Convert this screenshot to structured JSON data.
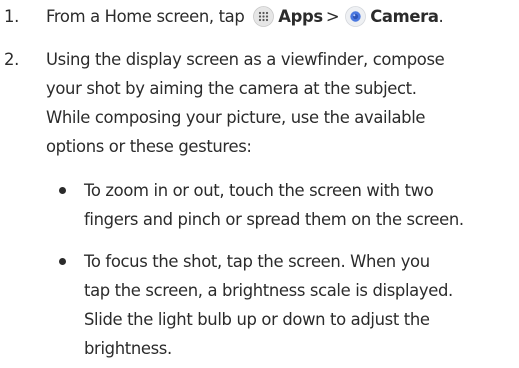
{
  "steps": [
    {
      "number": "1.",
      "line1": {
        "prefix": "From a Home screen, tap",
        "apps_icon": "apps-grid-icon",
        "apps_label": "Apps",
        "separator": ">",
        "camera_icon": "camera-app-icon",
        "camera_label": "Camera",
        "suffix": "."
      }
    },
    {
      "number": "2.",
      "lines": [
        "Using the display screen as a viewfinder, compose",
        "your shot by aiming the camera at the subject.",
        "While composing your picture, use the available",
        "options or these gestures:"
      ]
    }
  ],
  "bullets": [
    {
      "lines": [
        "To zoom in or out, touch the screen with two",
        "fingers and pinch or spread them on the screen."
      ]
    },
    {
      "lines": [
        "To focus the shot, tap the screen. When you",
        "tap the screen, a brightness scale is displayed.",
        "Slide the light bulb up or down to adjust the",
        "brightness."
      ]
    }
  ],
  "colors": {
    "text": "#2b2b2b",
    "apps_icon_bg": "#e6e6e6",
    "camera_icon_bg": "#eef0f3",
    "camera_icon_lens": "#4a78e0"
  }
}
